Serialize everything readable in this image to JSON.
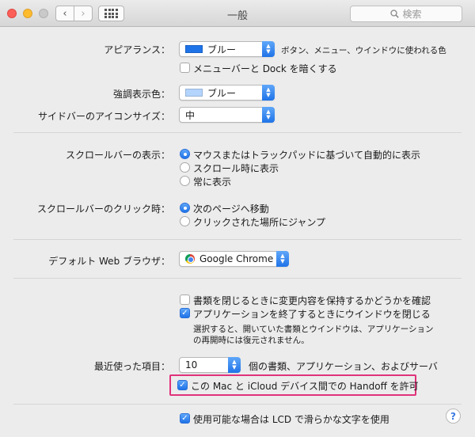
{
  "window": {
    "title": "一般",
    "search_placeholder": "検索",
    "nav_back": "‹",
    "nav_forward": "›"
  },
  "appearance": {
    "label": "アピアランス：",
    "value": "ブルー",
    "swatch_color": "#1f73e8",
    "note": "ボタン、メニュー、ウインドウに使われる色",
    "dark_menu_label": "メニューバーと Dock を暗くする",
    "dark_menu_checked": false
  },
  "highlight_color": {
    "label": "強調表示色：",
    "value": "ブルー",
    "swatch_color": "#b3d4fc"
  },
  "sidebar_icon_size": {
    "label": "サイドバーのアイコンサイズ：",
    "value": "中"
  },
  "scrollbars": {
    "label": "スクロールバーの表示：",
    "options": [
      {
        "label": "マウスまたはトラックパッドに基づいて自動的に表示",
        "selected": true
      },
      {
        "label": "スクロール時に表示",
        "selected": false
      },
      {
        "label": "常に表示",
        "selected": false
      }
    ]
  },
  "scroll_click": {
    "label": "スクロールバーのクリック時：",
    "options": [
      {
        "label": "次のページへ移動",
        "selected": true
      },
      {
        "label": "クリックされた場所にジャンプ",
        "selected": false
      }
    ]
  },
  "default_browser": {
    "label": "デフォルト Web ブラウザ：",
    "value": "Google Chrome"
  },
  "documents": {
    "ask_keep_changes": {
      "label": "書類を閉じるときに変更内容を保持するかどうかを確認",
      "checked": false
    },
    "close_windows": {
      "label": "アプリケーションを終了するときにウインドウを閉じる",
      "checked": true
    },
    "note_line1": "選択すると、開いていた書類とウインドウは、アプリケーション",
    "note_line2": "の再開時には復元されません。"
  },
  "recent_items": {
    "label": "最近使った項目：",
    "value": "10",
    "suffix": "個の書類、アプリケーション、およびサーバ"
  },
  "handoff": {
    "label": "この Mac と iCloud デバイス間での Handoff を許可",
    "checked": true,
    "highlight_color": "#e0327a"
  },
  "lcd_smoothing": {
    "label": "使用可能な場合は LCD で滑らかな文字を使用",
    "checked": true
  },
  "help_label": "?"
}
